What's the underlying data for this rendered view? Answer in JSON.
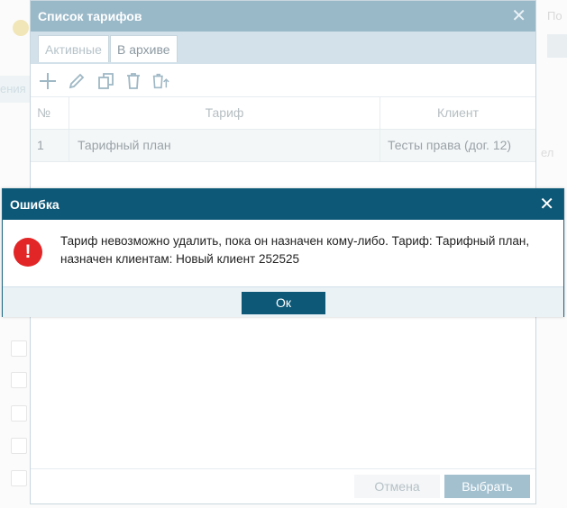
{
  "background": {
    "strip_text": "ения",
    "right_label": "По",
    "right_label_2": "ел"
  },
  "tariff_dialog": {
    "title": "Список тарифов",
    "close_glyph": "✕",
    "tabs": [
      {
        "label": "Активные",
        "active": false
      },
      {
        "label": "В архиве",
        "active": true
      }
    ],
    "toolbar_icons": [
      "add-icon",
      "edit-icon",
      "copy-icon",
      "delete-icon",
      "archive-icon"
    ],
    "table": {
      "columns": [
        "№",
        "Тариф",
        "Клиент"
      ],
      "rows": [
        {
          "num": "1",
          "tarif": "Тарифный план",
          "client": "Тесты права (дог. 12)"
        }
      ]
    },
    "cancel_label": "Отмена",
    "select_label": "Выбрать"
  },
  "error_dialog": {
    "title": "Ошибка",
    "close_glyph": "✕",
    "icon_glyph": "!",
    "message": "Тариф невозможно удалить, пока он назначен кому-либо. Тариф: Тарифный план, назначен клиентам: Новый клиент 252525",
    "ok_label": "Ок"
  },
  "colors": {
    "error_header": "#0d5877",
    "error_icon": "#e22526",
    "dialog_header": "#99b8c8"
  }
}
